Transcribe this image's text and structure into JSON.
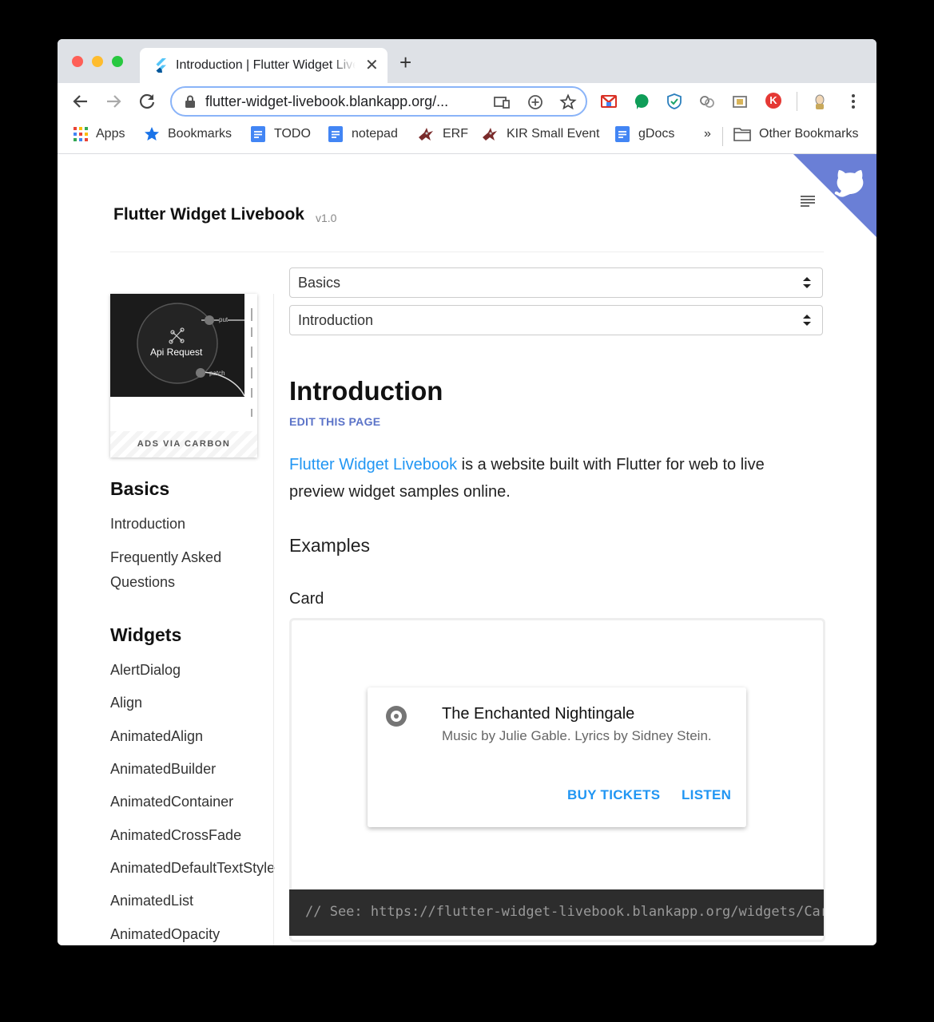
{
  "browser": {
    "tab_title": "Introduction | Flutter Widget Livebook",
    "new_tab_label": "+",
    "url": "flutter-widget-livebook.blankapp.org/...",
    "bookmarks": [
      {
        "label": "Apps",
        "icon": "apps-grid-icon"
      },
      {
        "label": "Bookmarks",
        "icon": "star-icon"
      },
      {
        "label": "TODO",
        "icon": "docs-icon"
      },
      {
        "label": "notepad",
        "icon": "docs-icon"
      },
      {
        "label": "ERF",
        "icon": "bird-icon"
      },
      {
        "label": "KIR Small Event",
        "icon": "bird-icon"
      },
      {
        "label": "gDocs",
        "icon": "docs-icon"
      }
    ],
    "overflow_label": "»",
    "other_bookmarks": "Other Bookmarks",
    "extension_profile_letter": "K"
  },
  "site": {
    "title": "Flutter Widget Livebook",
    "version": "v1.0"
  },
  "ad": {
    "image_label": "Api Request",
    "tag_put": "put",
    "tag_patch": "patch",
    "footer": "ADS VIA CARBON"
  },
  "sidebar": {
    "sections": [
      {
        "heading": "Basics",
        "items": [
          "Introduction",
          "Frequently Asked Questions"
        ]
      },
      {
        "heading": "Widgets",
        "items": [
          "AlertDialog",
          "Align",
          "AnimatedAlign",
          "AnimatedBuilder",
          "AnimatedContainer",
          "AnimatedCrossFade",
          "AnimatedDefaultTextStyle",
          "AnimatedList",
          "AnimatedOpacity"
        ]
      }
    ]
  },
  "main": {
    "category_select": "Basics",
    "page_select": "Introduction",
    "heading": "Introduction",
    "edit_link": "EDIT THIS PAGE",
    "intro_link": "Flutter Widget Livebook",
    "intro_text": " is a website built with Flutter for web to live preview widget samples online.",
    "examples_heading": "Examples",
    "card_heading": "Card",
    "card": {
      "title": "The Enchanted Nightingale",
      "subtitle": "Music by Julie Gable. Lyrics by Sidney Stein.",
      "button_1": "BUY TICKETS",
      "button_2": "LISTEN"
    },
    "code": "// See: https://flutter-widget-livebook.blankapp.org/widgets/Card/"
  },
  "colors": {
    "accent": "#2196f3",
    "edit_link": "#5b73c8",
    "github_corner": "#6a7fd6",
    "code_bg": "#2d2d2d"
  }
}
